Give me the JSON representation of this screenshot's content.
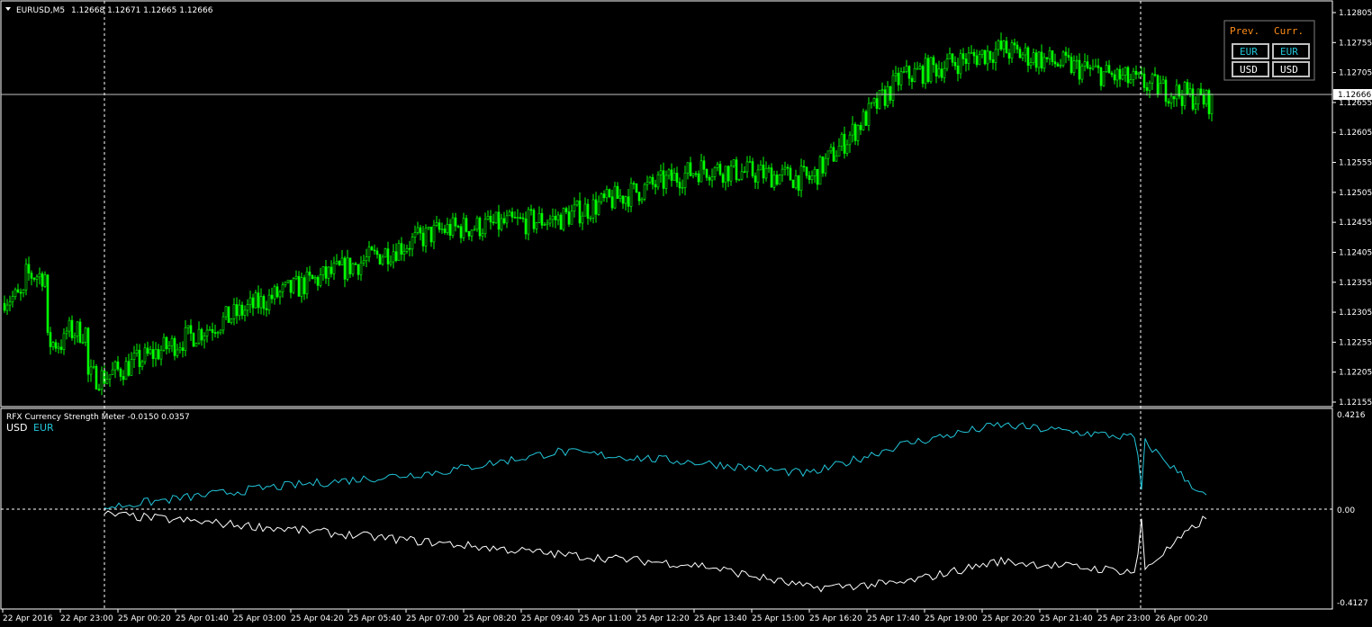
{
  "main_panel": {
    "symbol_label": "EURUSD,M5",
    "ohlc_text": "1.12668 1.12671 1.12665 1.12666",
    "price_ticks": [
      "1.12805",
      "1.12755",
      "1.12705",
      "1.12655",
      "1.12605",
      "1.12555",
      "1.12505",
      "1.12455",
      "1.12405",
      "1.12355",
      "1.12305",
      "1.12255",
      "1.12205",
      "1.12155"
    ],
    "current_price_label": "1.12666"
  },
  "indicator_panel": {
    "title": "RFX Currency Strength Meter -0.0150 0.0357",
    "legend": [
      {
        "label": "USD",
        "color": "#ffffff"
      },
      {
        "label": "EUR",
        "color": "#22c5d8"
      }
    ],
    "scale_labels": {
      "top": "0.4216",
      "zero": "0.00",
      "bottom": "-0.4127"
    }
  },
  "strength_box": {
    "prev_label": "Prev.",
    "curr_label": "Curr.",
    "buttons": [
      {
        "text": "EUR",
        "color": "#22c5d8"
      },
      {
        "text": "EUR",
        "color": "#22c5d8"
      },
      {
        "text": "USD",
        "color": "#ffffff"
      },
      {
        "text": "USD",
        "color": "#ffffff"
      }
    ]
  },
  "time_axis": [
    "22 Apr 2016",
    "22 Apr 23:00",
    "25 Apr 00:20",
    "25 Apr 01:40",
    "25 Apr 03:00",
    "25 Apr 04:20",
    "25 Apr 05:40",
    "25 Apr 07:00",
    "25 Apr 08:20",
    "25 Apr 09:40",
    "25 Apr 11:00",
    "25 Apr 12:20",
    "25 Apr 13:40",
    "25 Apr 15:00",
    "25 Apr 16:20",
    "25 Apr 17:40",
    "25 Apr 19:00",
    "25 Apr 20:20",
    "25 Apr 21:40",
    "25 Apr 23:00",
    "26 Apr 00:20"
  ],
  "colors": {
    "bull": "#00ff00",
    "bear": "#00ff00",
    "eur_line": "#22c5d8",
    "usd_line": "#ffffff",
    "grid": "#ffffff",
    "axis_text": "#ffffff",
    "box_prev": "#ff8c1a",
    "box_curr": "#ff8c1a"
  },
  "chart_data": {
    "type": "line",
    "x": [
      "22 Apr 23:00",
      "25 Apr 03:00",
      "25 Apr 07:00",
      "25 Apr 09:40",
      "25 Apr 12:20",
      "25 Apr 15:00",
      "25 Apr 17:40",
      "25 Apr 20:20",
      "25 Apr 23:00",
      "26 Apr 00:20"
    ],
    "series": [
      {
        "values": [
          1.1218,
          1.1232,
          1.1244,
          1.1246,
          1.1255,
          1.1253,
          1.1271,
          1.1276,
          1.127,
          1.12666
        ]
      },
      {
        "name": "EUR",
        "values": [
          0.01,
          0.1,
          0.17,
          0.26,
          0.21,
          0.16,
          0.29,
          0.38,
          0.32,
          0.0357
        ]
      },
      {
        "name": "USD",
        "values": [
          -0.02,
          -0.08,
          -0.15,
          -0.2,
          -0.25,
          -0.35,
          -0.33,
          -0.23,
          -0.28,
          -0.015
        ]
      }
    ],
    "ylim_price": [
      1.12135,
      1.12825
    ],
    "ylim_indicator": [
      -0.4127,
      0.4216
    ],
    "grid": false
  }
}
